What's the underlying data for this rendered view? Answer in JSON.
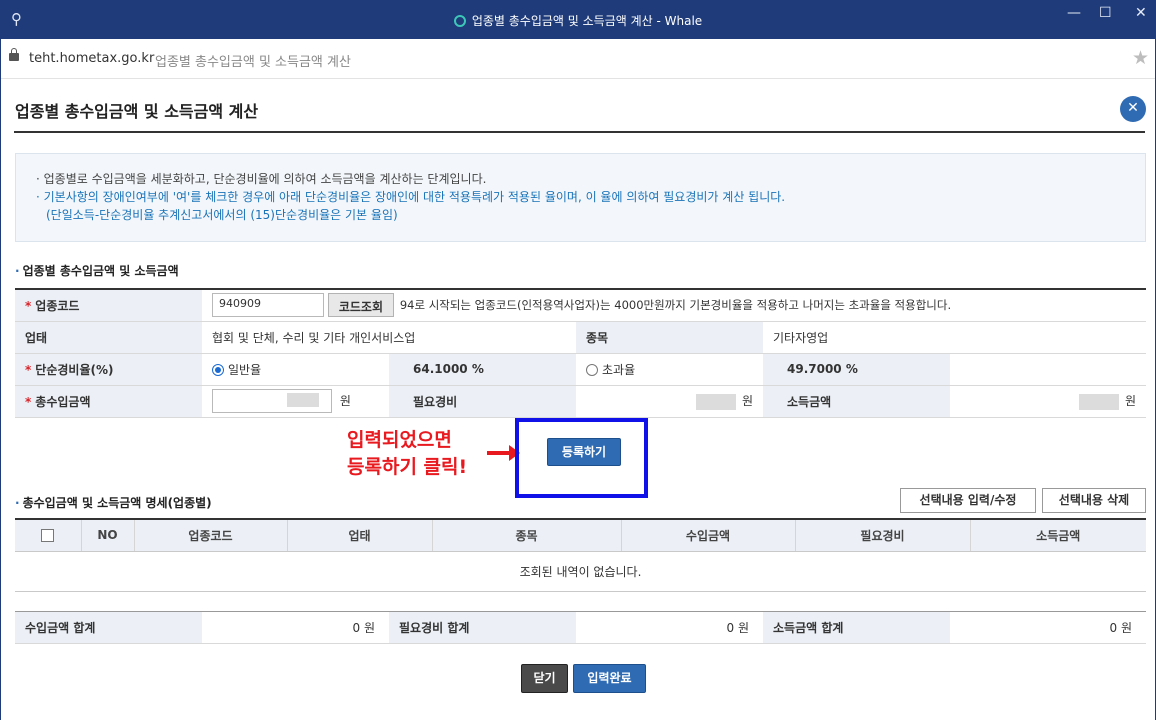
{
  "window": {
    "title": "업종별 총수입금액 및 소득금액 계산 - Whale",
    "controls": {
      "minimize": "—",
      "maximize": "☐",
      "close": "✕"
    }
  },
  "address": {
    "domain": "teht.hometax.go.kr",
    "page_title": "업종별 총수입금액 및 소득금액 계산"
  },
  "page": {
    "heading": "업종별 총수입금액 및 소득금액 계산"
  },
  "notice": {
    "line1": "· 업종별로 수입금액을 세분화하고, 단순경비율에 의하여 소득금액을 계산하는 단계입니다.",
    "line2": "· 기본사항의 장애인여부에 '여'를 체크한 경우에 아래 단순경비율은 장애인에 대한 적용특례가 적용된 율이며, 이 율에 의하여 필요경비가 계산 됩니다.",
    "line3": "(단일소득-단순경비율 추계신고서에서의 (15)단순경비율은 기본 율임)"
  },
  "form": {
    "section_title": "업종별 총수입금액 및 소득금액",
    "code_label": "업종코드",
    "code_value": "940909",
    "code_lookup_btn": "코드조회",
    "code_help": "94로 시작되는 업종코드(인적용역사업자)는 4000만원까지 기본경비율을 적용하고 나머지는 초과율을 적용합니다.",
    "business_type_label": "업태",
    "business_type_value": "협회 및 단체, 수리 및 기타 개인서비스업",
    "item_label": "종목",
    "item_value": "기타자영업",
    "rate_label": "단순경비율(%)",
    "rate_general_label": "일반율",
    "rate_general_value": "64.1000 %",
    "rate_excess_label": "초과율",
    "rate_excess_value": "49.7000 %",
    "income_label": "총수입금액",
    "won": "원",
    "expense_label": "필요경비",
    "net_label": "소득금액"
  },
  "annotation": {
    "line1": "입력되었으면",
    "line2": "등록하기 클릭!"
  },
  "register_btn": "등록하기",
  "list": {
    "section_title": "총수입금액 및 소득금액 명세(업종별)",
    "edit_btn": "선택내용 입력/수정",
    "delete_btn": "선택내용 삭제",
    "columns": [
      "NO",
      "업종코드",
      "업태",
      "종목",
      "수입금액",
      "필요경비",
      "소득금액"
    ],
    "empty_text": "조회된 내역이 없습니다."
  },
  "totals": {
    "income_total_label": "수입금액 합계",
    "income_total_value": "0 원",
    "expense_total_label": "필요경비 합계",
    "expense_total_value": "0 원",
    "net_total_label": "소득금액 합계",
    "net_total_value": "0 원"
  },
  "buttons": {
    "close": "닫기",
    "complete": "입력완료"
  }
}
